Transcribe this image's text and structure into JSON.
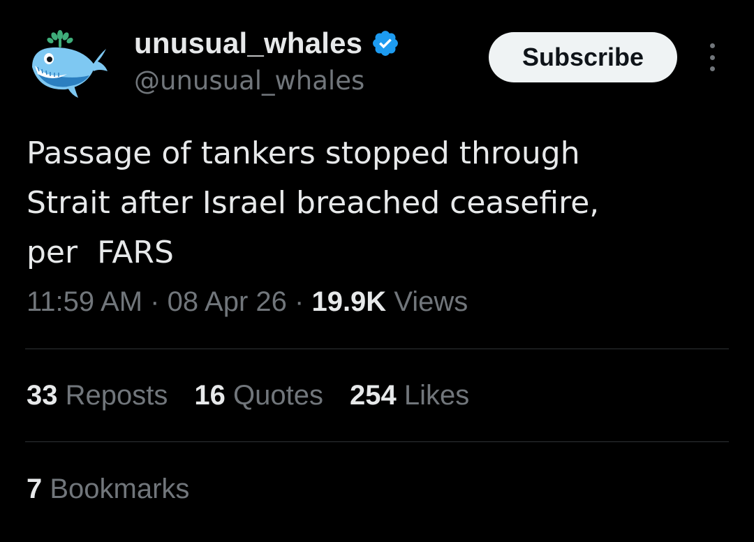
{
  "author": {
    "display_name": "unusual_whales",
    "handle": "@unusual_whales",
    "verified": true,
    "avatar_icon": "whale-icon",
    "verified_color": "#1d9bf0"
  },
  "header": {
    "subscribe_label": "Subscribe",
    "more_icon": "more-vertical-icon"
  },
  "tweet": {
    "lines": [
      "Passage of tankers stopped through",
      "Strait after Israel breached ceasefire,",
      "per  FARS"
    ],
    "time": "11:59 AM",
    "date": "08 Apr 26",
    "separator": "·",
    "views_count": "19.9K",
    "views_label": "Views"
  },
  "stats": {
    "reposts_count": "33",
    "reposts_label": "Reposts",
    "quotes_count": "16",
    "quotes_label": "Quotes",
    "likes_count": "254",
    "likes_label": "Likes",
    "bookmarks_count": "7",
    "bookmarks_label": "Bookmarks"
  },
  "colors": {
    "background": "#000000",
    "text_primary": "#e7e9ea",
    "text_secondary": "#71767b",
    "divider": "#2f3336",
    "button_bg": "#eff3f4",
    "button_text": "#0f1419"
  }
}
